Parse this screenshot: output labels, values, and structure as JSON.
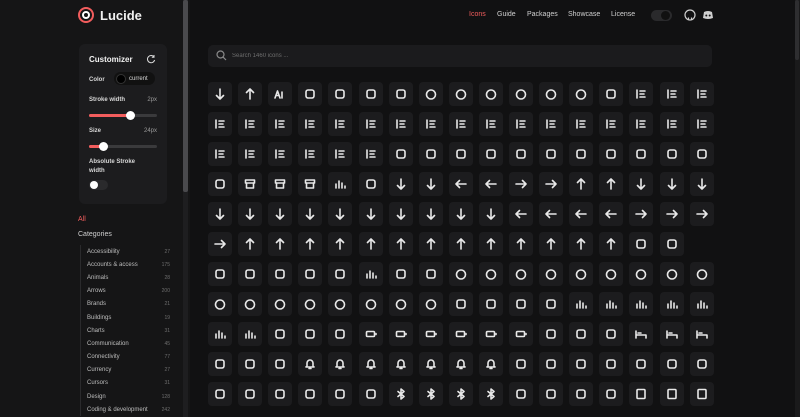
{
  "app": {
    "name": "Lucide",
    "accent": "#f25d5d"
  },
  "nav": {
    "links": [
      "Icons",
      "Guide",
      "Packages",
      "Showcase",
      "License"
    ],
    "active": "Icons",
    "icons": [
      "theme-toggle-icon",
      "github-icon",
      "discord-icon"
    ]
  },
  "customizer": {
    "title": "Customizer",
    "color_label": "Color",
    "color_value": "current",
    "stroke_label": "Stroke width",
    "stroke_value": "2px",
    "stroke_fraction": 0.6,
    "size_label": "Size",
    "size_value": "24px",
    "size_fraction": 0.2,
    "absolute_label_line1": "Absolute Stroke",
    "absolute_label_line2": "width",
    "absolute_on": false
  },
  "categories": {
    "all_label": "All",
    "title": "Categories",
    "items": [
      {
        "name": "Accessibility",
        "count": "27"
      },
      {
        "name": "Accounts & access",
        "count": "175"
      },
      {
        "name": "Animals",
        "count": "28"
      },
      {
        "name": "Arrows",
        "count": "200"
      },
      {
        "name": "Brands",
        "count": "21"
      },
      {
        "name": "Buildings",
        "count": "19"
      },
      {
        "name": "Charts",
        "count": "31"
      },
      {
        "name": "Communication",
        "count": "45"
      },
      {
        "name": "Connectivity",
        "count": "77"
      },
      {
        "name": "Currency",
        "count": "27"
      },
      {
        "name": "Cursors",
        "count": "31"
      },
      {
        "name": "Design",
        "count": "128"
      },
      {
        "name": "Coding & development",
        "count": "242"
      }
    ]
  },
  "search": {
    "placeholder": "Search 1460 icons ..."
  },
  "grid": {
    "rows": [
      [
        "a-arrow-down-icon",
        "a-arrow-up-icon",
        "a-large-small-icon",
        "accessibility-icon",
        "activity-icon",
        "air-vent-icon",
        "airplay-icon",
        "alarm-clock-icon",
        "alarm-clock-check-icon",
        "alarm-clock-minus-icon",
        "alarm-clock-off-icon",
        "alarm-clock-plus-icon",
        "alarm-smoke-icon",
        "album-icon",
        "align-center-icon",
        "align-center-horizontal-icon",
        "align-center-vertical-icon"
      ],
      [
        "align-end-horizontal-icon",
        "align-end-vertical-icon",
        "align-horizontal-distribute-center-icon",
        "align-horizontal-distribute-end-icon",
        "align-horizontal-distribute-start-icon",
        "align-horizontal-justify-center-icon",
        "align-horizontal-justify-end-icon",
        "align-horizontal-justify-start-icon",
        "align-horizontal-space-around-icon",
        "align-horizontal-space-between-icon",
        "align-justify-icon",
        "align-left-icon",
        "align-right-icon",
        "align-start-horizontal-icon",
        "align-start-vertical-icon",
        "align-vertical-distribute-center-icon",
        "align-vertical-distribute-end-icon"
      ],
      [
        "align-vertical-distribute-start-icon",
        "align-vertical-justify-center-icon",
        "align-vertical-justify-end-icon",
        "align-vertical-justify-start-icon",
        "align-vertical-space-around-icon",
        "align-vertical-space-between-icon",
        "ambulance-icon",
        "ampersand-icon",
        "ampersands-icon",
        "anchor-icon",
        "angry-icon",
        "annoyed-icon",
        "antenna-icon",
        "anvil-icon",
        "aperture-icon",
        "app-window-icon",
        "app-window-mac-icon"
      ],
      [
        "apple-icon",
        "archive-icon",
        "archive-restore-icon",
        "archive-x-icon",
        "area-chart-icon",
        "armchair-icon",
        "arrow-big-down-icon",
        "arrow-big-down-dash-icon",
        "arrow-big-left-icon",
        "arrow-big-left-dash-icon",
        "arrow-big-right-icon",
        "arrow-big-right-dash-icon",
        "arrow-big-up-icon",
        "arrow-big-up-dash-icon",
        "arrow-down-icon",
        "arrow-down-0-1-icon",
        "arrow-down-1-0-icon"
      ],
      [
        "arrow-down-a-z-icon",
        "arrow-down-from-line-icon",
        "arrow-down-left-icon",
        "arrow-down-narrow-wide-icon",
        "arrow-down-right-icon",
        "arrow-down-to-dot-icon",
        "arrow-down-to-line-icon",
        "arrow-down-up-icon",
        "arrow-down-wide-narrow-icon",
        "arrow-down-z-a-icon",
        "arrow-left-icon",
        "arrow-left-from-line-icon",
        "arrow-left-right-icon",
        "arrow-left-to-line-icon",
        "arrow-right-icon",
        "arrow-right-from-line-icon",
        "arrow-right-left-icon"
      ],
      [
        "arrow-right-to-line-icon",
        "arrow-up-icon",
        "arrow-up-0-1-icon",
        "arrow-up-1-0-icon",
        "arrow-up-down-icon",
        "arrow-up-from-dot-icon",
        "arrow-up-from-line-icon",
        "arrow-up-left-icon",
        "arrow-up-narrow-wide-icon",
        "arrow-up-right-icon",
        "arrow-up-to-line-icon",
        "arrow-up-wide-narrow-icon",
        "arrow-up-z-a-icon",
        "arrows-up-from-line-icon",
        "asterisk-icon",
        "at-sign-icon"
      ],
      [
        "atom-icon",
        "audio-lines-icon",
        "audio-waveform-icon",
        "award-icon",
        "axe-icon",
        "axis-3d-icon",
        "baby-icon",
        "backpack-icon",
        "badge-icon",
        "badge-alert-icon",
        "badge-cent-icon",
        "badge-check-icon",
        "badge-dollar-sign-icon",
        "badge-euro-icon",
        "badge-help-icon",
        "badge-indian-rupee-icon",
        "badge-info-icon"
      ],
      [
        "badge-japanese-yen-icon",
        "badge-minus-icon",
        "badge-percent-icon",
        "badge-plus-icon",
        "badge-pound-sterling-icon",
        "badge-russian-ruble-icon",
        "badge-swiss-franc-icon",
        "badge-x-icon",
        "baggage-claim-icon",
        "ban-icon",
        "banana-icon",
        "banknote-icon",
        "bar-chart-icon",
        "bar-chart-2-icon",
        "bar-chart-3-icon",
        "bar-chart-4-icon",
        "bar-chart-big-icon"
      ],
      [
        "bar-chart-horizontal-icon",
        "bar-chart-horizontal-big-icon",
        "barcode-icon",
        "baseline-icon",
        "bath-icon",
        "battery-icon",
        "battery-charging-icon",
        "battery-full-icon",
        "battery-low-icon",
        "battery-medium-icon",
        "battery-warning-icon",
        "beaker-icon",
        "bean-icon",
        "bean-off-icon",
        "bed-icon",
        "bed-double-icon",
        "bed-single-icon"
      ],
      [
        "beef-icon",
        "beer-icon",
        "beer-off-icon",
        "bell-icon",
        "bell-dot-icon",
        "bell-electric-icon",
        "bell-minus-icon",
        "bell-off-icon",
        "bell-plus-icon",
        "bell-ring-icon",
        "between-horizontal-end-icon",
        "between-horizontal-start-icon",
        "between-vertical-end-icon",
        "between-vertical-start-icon",
        "bicycle-icon",
        "bike-icon",
        "binary-icon"
      ],
      [
        "biohazard-icon",
        "bird-icon",
        "bitcoin-icon",
        "blend-icon",
        "blinds-icon",
        "blocks-icon",
        "bluetooth-icon",
        "bluetooth-connected-icon",
        "bluetooth-off-icon",
        "bluetooth-searching-icon",
        "bold-icon",
        "bolt-icon",
        "bomb-icon",
        "bone-icon",
        "book-icon",
        "book-a-icon",
        "book-audio-icon"
      ]
    ]
  }
}
